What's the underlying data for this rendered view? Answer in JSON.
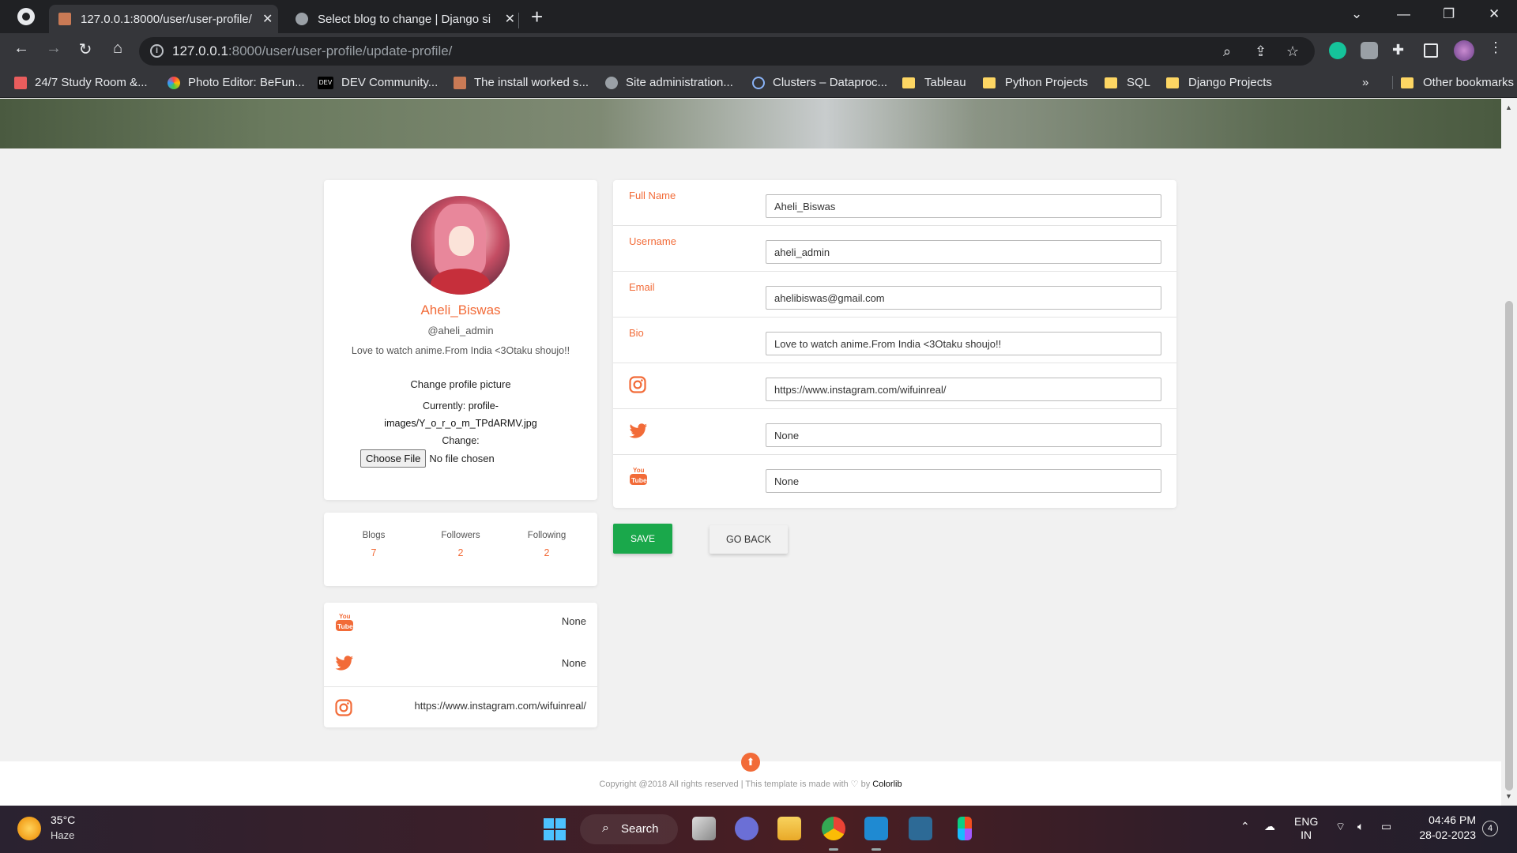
{
  "browser": {
    "tabs": [
      {
        "title": "127.0.0.1:8000/user/user-profile/",
        "active": true
      },
      {
        "title": "Select blog to change | Django si",
        "active": false
      }
    ],
    "url_host": "127.0.0.1",
    "url_rest": ":8000/user/user-profile/update-profile/",
    "bookmarks": [
      {
        "label": "24/7 Study Room &...",
        "icon": "study-room-icon"
      },
      {
        "label": "Photo Editor: BeFun...",
        "icon": "befunky-icon"
      },
      {
        "label": "DEV Community...",
        "icon": "dev-icon"
      },
      {
        "label": "The install worked s...",
        "icon": "django-icon"
      },
      {
        "label": "Site administration...",
        "icon": "globe-icon"
      },
      {
        "label": "Clusters – Dataproc...",
        "icon": "dataproc-icon"
      },
      {
        "label": "Tableau",
        "icon": "folder-icon"
      },
      {
        "label": "Python Projects",
        "icon": "folder-icon"
      },
      {
        "label": "SQL",
        "icon": "folder-icon"
      },
      {
        "label": "Django Projects",
        "icon": "folder-icon"
      }
    ],
    "bookmarks_more": "»",
    "other_bookmarks": "Other bookmarks"
  },
  "profile": {
    "name": "Aheli_Biswas",
    "handle": "@aheli_admin",
    "bio": "Love to watch anime.From India <3Otaku shoujo!!",
    "change_picture_title": "Change profile picture",
    "currently_label": "Currently:",
    "current_file": "profile-images/Y_o_r_o_m_TPdARMV.jpg",
    "change_label": "Change:",
    "choose_file": "Choose File",
    "no_file": "No file chosen"
  },
  "stats": [
    {
      "label": "Blogs",
      "value": "7"
    },
    {
      "label": "Followers",
      "value": "2"
    },
    {
      "label": "Following",
      "value": "2"
    }
  ],
  "social_summary": {
    "youtube": "None",
    "twitter": "None",
    "instagram": "https://www.instagram.com/wifuinreal/"
  },
  "form": {
    "full_name_label": "Full Name",
    "full_name": "Aheli_Biswas",
    "username_label": "Username",
    "username": "aheli_admin",
    "email_label": "Email",
    "email": "ahelibiswas@gmail.com",
    "bio_label": "Bio",
    "bio": "Love to watch anime.From India <3Otaku shoujo!!",
    "instagram": "https://www.instagram.com/wifuinreal/",
    "twitter": "None",
    "youtube": "None"
  },
  "buttons": {
    "save": "SAVE",
    "go_back": "GO BACK"
  },
  "footer": {
    "text": "Copyright @2018 All rights reserved | This template is made with ♡ by",
    "brand": "Colorlib"
  },
  "taskbar": {
    "temp": "35°C",
    "weather": "Haze",
    "search": "Search",
    "lang1": "ENG",
    "lang2": "IN",
    "time": "04:46 PM",
    "date": "28-02-2023",
    "notifications": "4"
  },
  "colors": {
    "accent": "#f26b38",
    "save": "#1aa84b",
    "chrome_dark": "#202124",
    "chrome_mid": "#35363a"
  }
}
